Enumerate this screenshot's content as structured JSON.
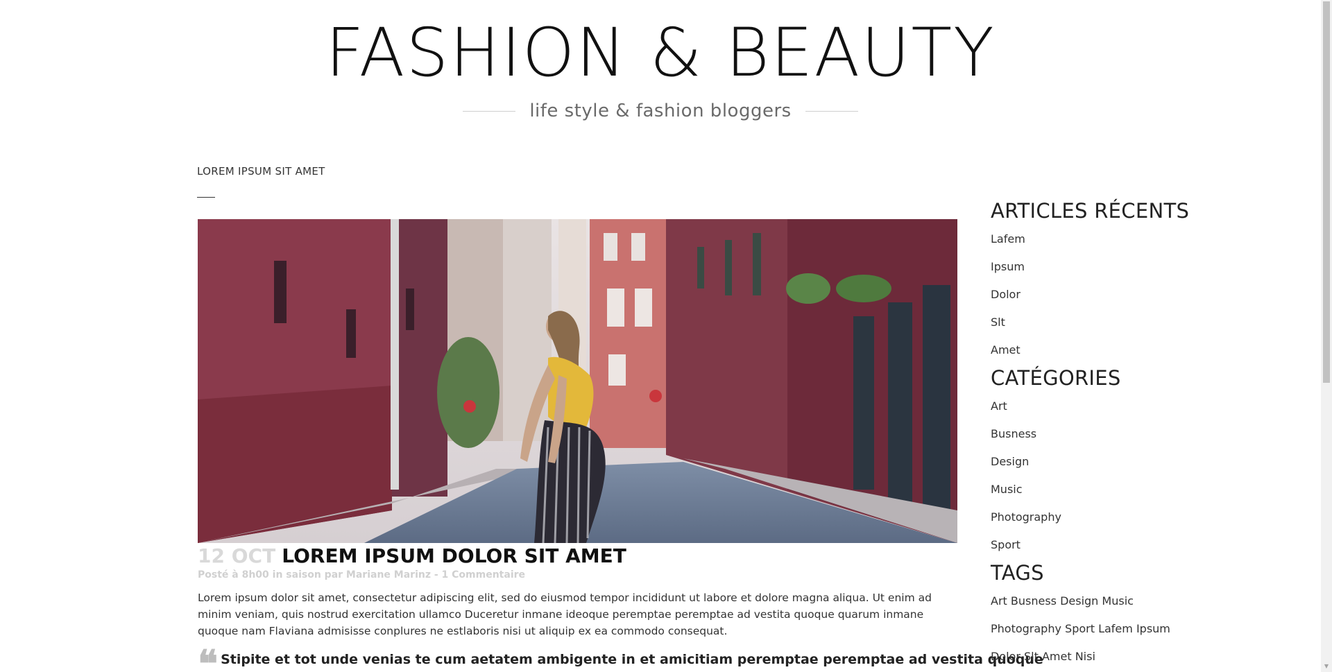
{
  "site": {
    "title": "FASHION & BEAUTY",
    "tagline": "life style & fashion bloggers"
  },
  "breadcrumb": "LOREM IPSUM SIT AMET",
  "post": {
    "image_alt": "Woman in yellow top and striped pants on city street",
    "date": "12 OCT",
    "title": "LOREM IPSUM DOLOR SIT AMET",
    "meta": "Posté à 8h00 in saison par Mariane Marinz - 1 Commentaire",
    "excerpt": "Lorem ipsum dolor sit amet, consectetur adipiscing elit, sed do eiusmod tempor incididunt ut labore et dolore magna aliqua. Ut enim ad minim veniam, quis nostrud exercitation ullamco Duceretur inmane ideoque peremptae peremptae ad vestita quoque quarum inmane quoque nam Flaviana admisisse conplures ne estlaboris nisi ut aliquip ex ea commodo consequat.",
    "quote": "Stipite et tot unde venias te cum aetatem ambigente in et amicitiam peremptae peremptae ad vestita quoque"
  },
  "sidebar": {
    "recent": {
      "title": "ARTICLES RÉCENTS",
      "items": [
        "Lafem",
        "Ipsum",
        "Dolor",
        "Slt",
        "Amet"
      ]
    },
    "categories": {
      "title": "CATÉGORIES",
      "items": [
        "Art",
        "Busness",
        "Design",
        "Music",
        "Photography",
        "Sport"
      ]
    },
    "tags": {
      "title": "TAGS",
      "items": [
        "Art Busness Design Music",
        "Photography Sport Lafem Ipsum",
        "Dolor Slt Amet Nisi"
      ]
    }
  },
  "colors": {
    "date": "#d9d9d9",
    "meta": "#d0d0d0",
    "tagline": "#6a6a6a"
  }
}
